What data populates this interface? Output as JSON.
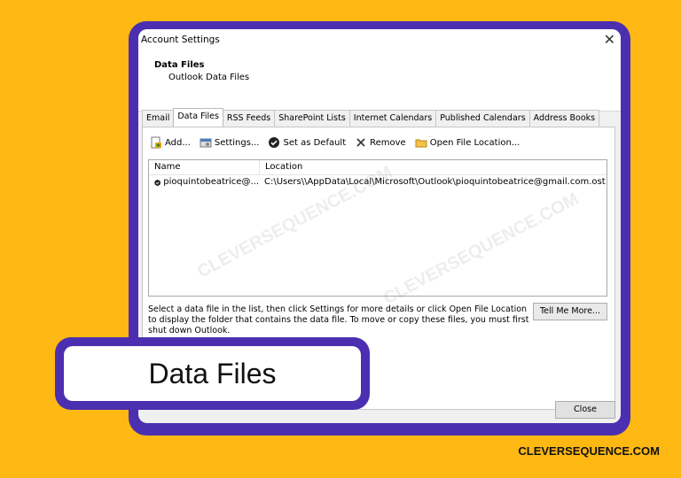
{
  "dialog": {
    "title": "Account Settings",
    "section_title": "Data Files",
    "section_subtitle": "Outlook Data Files",
    "tabs": [
      {
        "label": "Email"
      },
      {
        "label": "Data Files"
      },
      {
        "label": "RSS Feeds"
      },
      {
        "label": "SharePoint Lists"
      },
      {
        "label": "Internet Calendars"
      },
      {
        "label": "Published Calendars"
      },
      {
        "label": "Address Books"
      }
    ],
    "active_tab": "Data Files",
    "toolbar": {
      "add": "Add...",
      "settings": "Settings...",
      "set_default": "Set as Default",
      "remove": "Remove",
      "open_location": "Open File Location..."
    },
    "list": {
      "headers": {
        "name": "Name",
        "location": "Location"
      },
      "rows": [
        {
          "name": "pioquintobeatrice@...",
          "location": "C:\\Users\\\\AppData\\Local\\Microsoft\\Outlook\\pioquintobeatrice@gmail.com.ost"
        }
      ]
    },
    "description": "Select a data file in the list, then click Settings for more details or click Open File Location to display the folder that contains the data file. To move or copy these files, you must first shut down Outlook.",
    "tell_me_more": "Tell Me More...",
    "close": "Close"
  },
  "callout": {
    "text": "Data Files"
  },
  "brand": "CLEVERSEQUENCE.COM",
  "watermark": "CLEVERSEQUENCE.COM",
  "colors": {
    "background": "#FDB813",
    "frame": "#4B2FB0"
  }
}
